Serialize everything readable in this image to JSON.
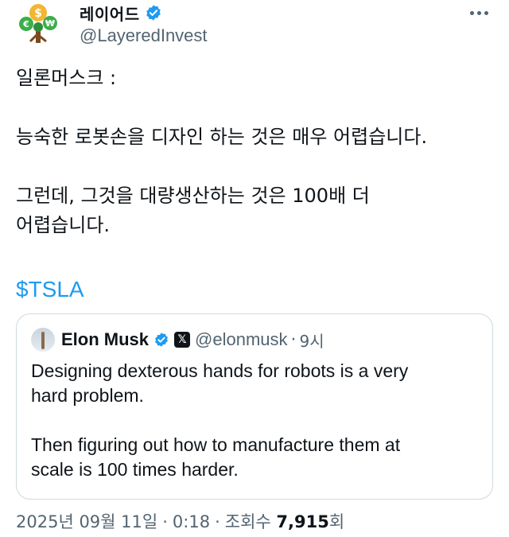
{
  "author": {
    "display_name": "레이어드",
    "handle": "@LayeredInvest",
    "avatar": "money-tree-logo",
    "verified": true
  },
  "tweet": {
    "text": "일론머스크 :\n\n능숙한 로봇손을 디자인 하는 것은 매우 어렵습니다.\n\n그런데, 그것을 대량생산하는 것은 100배 더\n어렵습니다.",
    "cashtag": "$TSLA"
  },
  "quoted_tweet": {
    "name": "Elon Musk",
    "handle": "@elonmusk",
    "separator": "·",
    "time": "9시",
    "text": "Designing dexterous hands for robots is a very\nhard problem.\n\nThen figuring out how to manufacture them at\nscale is 100 times harder."
  },
  "meta": {
    "date": "2025년 09월 11일",
    "time": "0:18",
    "views_label": "조회수",
    "views": "7,915",
    "views_suffix": "회",
    "separator": "·"
  },
  "colors": {
    "accent": "#1d9bf0",
    "text": "#0f1419",
    "secondary": "#536471",
    "border": "#cfd9de"
  }
}
